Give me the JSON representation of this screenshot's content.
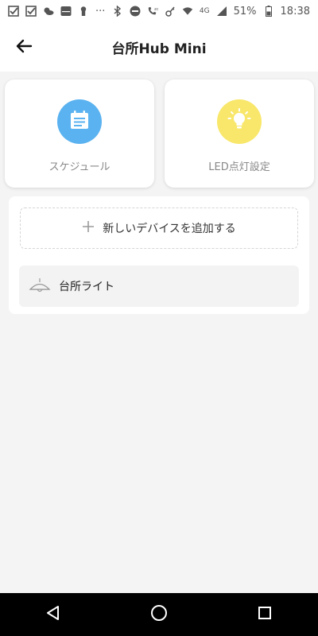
{
  "status_bar": {
    "battery": "51%",
    "time": "18:38",
    "network_4g": "4G",
    "more": "···",
    "icons": [
      "check-note-icon",
      "check-note-icon",
      "weather-icon",
      "au-pay-icon",
      "keyhole-icon",
      "bluetooth-icon",
      "do-not-disturb-icon",
      "volte-call-icon",
      "key-icon",
      "wifi-icon",
      "signal-icon",
      "battery-icon"
    ]
  },
  "header": {
    "title": "台所Hub Mini",
    "back_icon": "arrow-left-icon"
  },
  "cards": {
    "schedule": {
      "label": "スケジュール",
      "icon": "calendar-icon",
      "color": "#5AB2F0"
    },
    "led": {
      "label": "LED点灯設定",
      "icon": "lightbulb-icon",
      "color": "#F8E76A"
    }
  },
  "devices": {
    "add_label": "新しいデバイスを追加する",
    "items": [
      {
        "name": "台所ライト",
        "icon": "ceiling-lamp-icon"
      }
    ]
  },
  "nav": {
    "buttons": [
      "back-triangle-icon",
      "home-circle-icon",
      "recents-square-icon"
    ]
  }
}
